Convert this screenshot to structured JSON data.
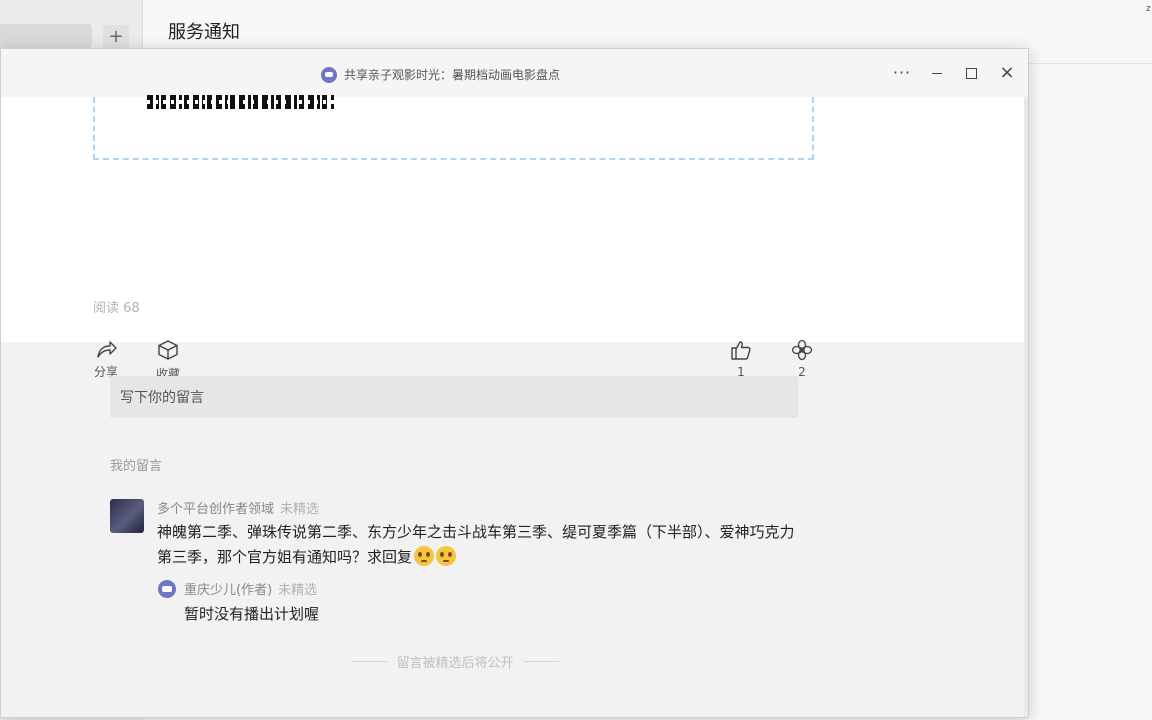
{
  "background": {
    "tab_add_label": "+",
    "header_title": "服务通知",
    "corner_text": "z"
  },
  "window": {
    "title": "共享亲子观影时光：暑期档动画电影盘点",
    "more_label": "···",
    "close_label": "×"
  },
  "article": {
    "read_count": "阅读 68",
    "actions": {
      "share": "分享",
      "favorite": "收藏",
      "like_count": "1",
      "watching_count": "2"
    }
  },
  "comments": {
    "input_placeholder": "写下你的留言",
    "section_label": "我的留言",
    "items": [
      {
        "author": "多个平台创作者领域",
        "status": "未精选",
        "text": "神魄第二季、弹珠传说第二季、东方少年之击斗战车第三季、缇可夏季篇（下半部）、爱神巧克力第三季，那个官方姐有通知吗？求回复",
        "reply": {
          "author": "重庆少儿(作者)",
          "status": "未精选",
          "text": "暂时没有播出计划喔"
        }
      }
    ],
    "footnote": "留言被精选后将公开"
  }
}
